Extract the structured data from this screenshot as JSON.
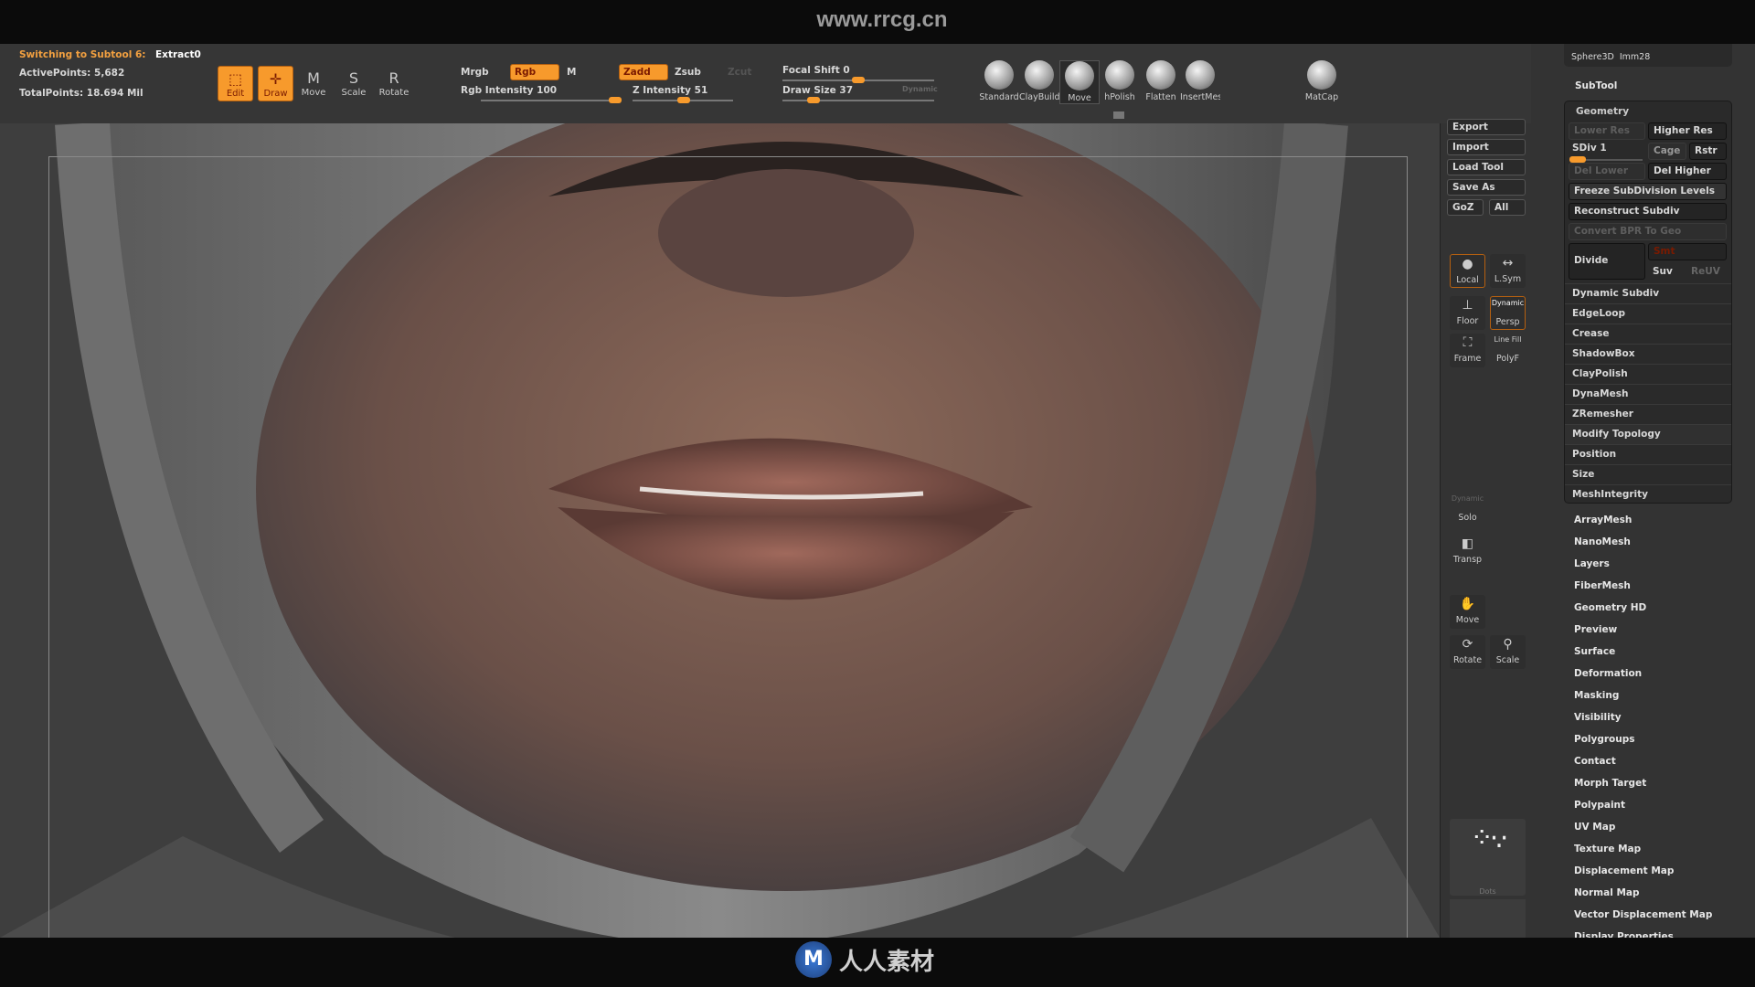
{
  "site": "www.rrcg.cn",
  "status": {
    "switching": "Switching to Subtool 6:",
    "subtool": "Extract0",
    "active_points": "ActivePoints: 5,682",
    "total_points": "TotalPoints: 18.694 Mil"
  },
  "modes": {
    "edit": "Edit",
    "draw": "Draw",
    "move": "Move",
    "scale": "Scale",
    "rotate": "Rotate"
  },
  "color": {
    "mrgb": "Mrgb",
    "rgb": "Rgb",
    "m": "M",
    "rgb_intensity_label": "Rgb Intensity 100",
    "rgb_intensity": 100
  },
  "z": {
    "zadd": "Zadd",
    "zsub": "Zsub",
    "zcut": "Zcut",
    "z_intensity_label": "Z Intensity 51",
    "z_intensity": 51
  },
  "brush": {
    "focal_shift_label": "Focal Shift 0",
    "focal_shift": 0,
    "draw_size_label": "Draw Size 37",
    "draw_size": 37,
    "dynamic": "Dynamic"
  },
  "brushes": [
    "Standard",
    "ClayBuildup",
    "Move",
    "hPolish",
    "Flatten",
    "InsertMesh"
  ],
  "matcap": "MatCap",
  "file": {
    "export": "Export",
    "import": "Import",
    "load_tool": "Load Tool",
    "save_as": "Save As",
    "goz": "GoZ",
    "all": "All"
  },
  "view": {
    "local": "Local",
    "lsym": "L.Sym",
    "floor": "Floor",
    "persp": "Persp",
    "dynamic": "Dynamic",
    "frame": "Frame",
    "linefill": "Line Fill",
    "polyf": "PolyF",
    "dynamic2": "Dynamic",
    "solo": "Solo",
    "transp": "Transp",
    "move": "Move",
    "rotate": "Rotate",
    "scale": "Scale",
    "dots": "Dots"
  },
  "tools": {
    "sphere": "Sphere3D",
    "imm": "Imm28"
  },
  "subtool": "SubTool",
  "geometry": {
    "title": "Geometry",
    "lower_res": "Lower Res",
    "higher_res": "Higher Res",
    "sdiv": "SDiv 1",
    "cage": "Cage",
    "rstr": "Rstr",
    "del_lower": "Del Lower",
    "del_higher": "Del Higher",
    "freeze": "Freeze SubDivision Levels",
    "reconstruct": "Reconstruct Subdiv",
    "convert": "Convert BPR To Geo",
    "divide": "Divide",
    "smt": "Smt",
    "suv": "Suv",
    "reuv": "ReUV",
    "items": [
      "Dynamic Subdiv",
      "EdgeLoop",
      "Crease",
      "ShadowBox",
      "ClayPolish",
      "DynaMesh",
      "ZRemesher",
      "Modify Topology",
      "Position",
      "Size",
      "MeshIntegrity"
    ]
  },
  "tool_menu": [
    "ArrayMesh",
    "NanoMesh",
    "Layers",
    "FiberMesh",
    "Geometry HD",
    "Preview",
    "Surface",
    "Deformation",
    "Masking",
    "Visibility",
    "Polygroups",
    "Contact",
    "Morph Target",
    "Polypaint",
    "UV Map",
    "Texture Map",
    "Displacement Map",
    "Normal Map",
    "Vector Displacement Map",
    "Display Properties"
  ],
  "footer_logo": "人人素材",
  "watermark": "RRCG 人人素材",
  "accent": "#f79a2c"
}
